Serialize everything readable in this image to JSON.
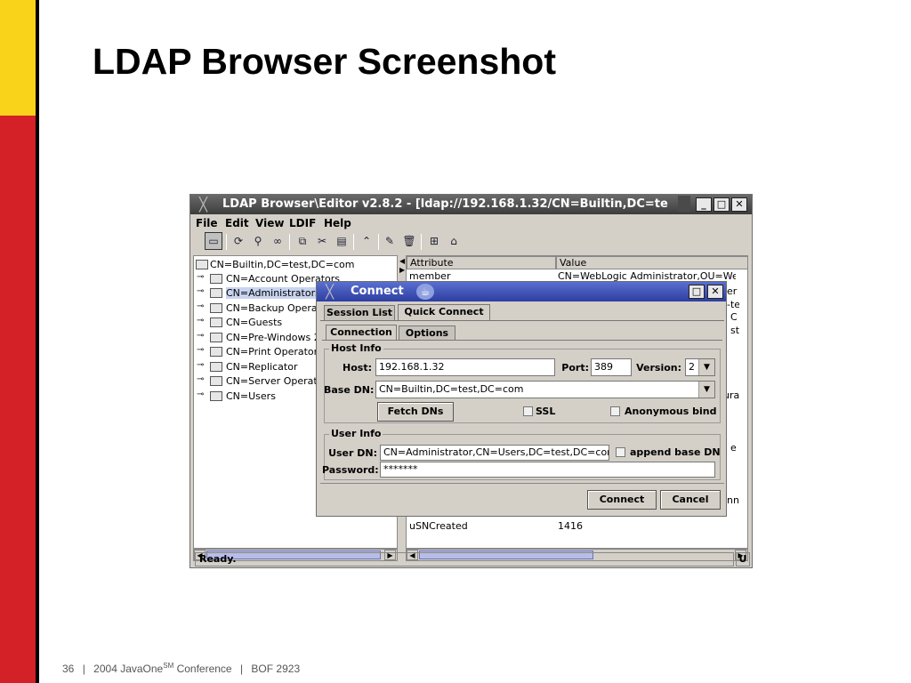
{
  "slide": {
    "title": "LDAP Browser Screenshot",
    "footer": {
      "page": "36",
      "sep": "|",
      "conference_prefix": "2004 JavaOne",
      "conference_sup": "SM",
      "conference_suffix": " Conference",
      "bof": "BOF 2923"
    }
  },
  "app": {
    "title": "LDAP Browser\\Editor v2.8.2 - [ldap://192.168.1.32/CN=Builtin,DC=te",
    "menu": [
      "File",
      "Edit",
      "View",
      "LDIF",
      "Help"
    ],
    "toolbar_icons": [
      "computer-icon",
      "refresh-icon",
      "search-icon",
      "binoculars-icon",
      "copy-icon",
      "cut-icon",
      "paste-icon",
      "up-icon",
      "edit-icon",
      "delete-icon",
      "add-entry-icon",
      "add-child-icon"
    ],
    "tree": {
      "root": "CN=Builtin,DC=test,DC=com",
      "children": [
        "CN=Account Operators",
        "CN=Administrators",
        "CN=Backup Operat",
        "CN=Guests",
        "CN=Pre-Windows 2",
        "CN=Print Operator",
        "CN=Replicator",
        "CN=Server Operato",
        "CN=Users"
      ],
      "selected": "CN=Administrators"
    },
    "attributes": {
      "headers": [
        "Attribute",
        "Value"
      ],
      "rows": [
        {
          "attr": "member",
          "value": "CN=WebLogic Administrator,OU=Web"
        },
        {
          "attr": "uSNCreated",
          "value": "1416"
        }
      ],
      "partial_values": [
        "er",
        "-te",
        "C",
        "st",
        "ura",
        "e",
        "nn"
      ]
    },
    "status": "Ready.",
    "status_right": "U"
  },
  "dialog": {
    "title": "Connect",
    "tabs": [
      "Session List",
      "Quick Connect"
    ],
    "subtabs": [
      "Connection",
      "Options"
    ],
    "host_info": {
      "group_label": "Host Info",
      "host_label": "Host:",
      "host_value": "192.168.1.32",
      "port_label": "Port:",
      "port_value": "389",
      "version_label": "Version:",
      "version_value": "2",
      "basedn_label": "Base DN:",
      "basedn_value": "CN=Builtin,DC=test,DC=com",
      "fetch_label": "Fetch DNs",
      "ssl_label": "SSL",
      "anon_label": "Anonymous bind"
    },
    "user_info": {
      "group_label": "User Info",
      "userdn_label": "User DN:",
      "userdn_value": "CN=Administrator,CN=Users,DC=test,DC=com",
      "append_label": "append base DN",
      "password_label": "Password:",
      "password_value": "*******"
    },
    "connect_label": "Connect",
    "cancel_label": "Cancel"
  }
}
